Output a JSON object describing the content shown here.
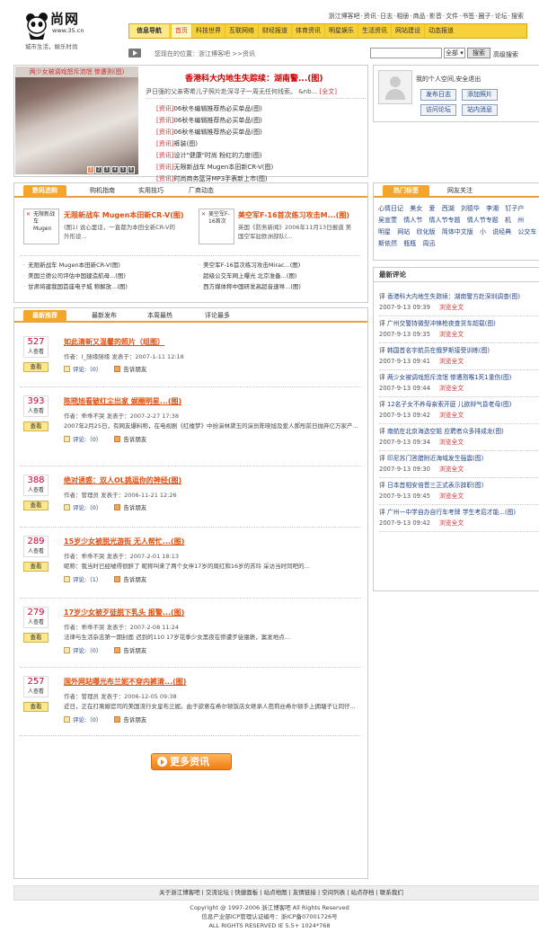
{
  "header": {
    "logo_text": "尚网",
    "logo_url": "www.35.cn",
    "logo_slogan": "城市生活，娱乐时尚",
    "top_links": [
      "浙江博客吧",
      "资讯",
      "日志",
      "相册",
      "商品",
      "影音",
      "文件",
      "书签",
      "圈子",
      "论坛",
      "搜索"
    ]
  },
  "nav": {
    "title": "信息导航",
    "items": [
      "首页",
      "科技世界",
      "互联网络",
      "财经报道",
      "体育资讯",
      "明星娱乐",
      "生活资讯",
      "网站建设",
      "动态报道"
    ]
  },
  "location": {
    "text": "您现在的位置：浙江博客吧 >>资讯"
  },
  "search": {
    "placeholder": "",
    "select_value": "全部",
    "button": "搜索",
    "advanced": "高级搜索"
  },
  "headline": {
    "photo_caption": "两少女被调戏怒斥流氓 惨遭割(图)",
    "photo_pages": [
      "1",
      "2",
      "3",
      "4",
      "5",
      "6"
    ],
    "title": "香港科大内地生失踪续：湖南警...(图)",
    "desc": "尹日强的父亲寄希儿子照片赴深寻子一周无任何线索。 &nb...",
    "more": "[全文]",
    "list": [
      {
        "tag": "[资讯]",
        "text": "06秋冬编辑推荐热必买单品(图)"
      },
      {
        "tag": "[资讯]",
        "text": "06秋冬编辑推荐热必买单品(图)"
      },
      {
        "tag": "[资讯]",
        "text": "06秋冬编辑推荐热必买单品(图)"
      },
      {
        "tag": "[资讯]",
        "text": "裤装(图)"
      },
      {
        "tag": "[资讯]",
        "text": "设计\"健康\"时尚 粉红的力度(图)"
      },
      {
        "tag": "[资讯]",
        "text": "无限新战车 Mugen本田新CR-V(图)"
      },
      {
        "tag": "[资讯]",
        "text": "时尚商务蓝牙MP3手表新上市(图)"
      }
    ]
  },
  "profile": {
    "text": "我的个人空间,安全退出",
    "buttons": [
      "发布日志",
      "添加照片",
      "访问论坛",
      "站内消息"
    ]
  },
  "buy": {
    "tabs": [
      "数码选购",
      "购机指南",
      "实用技巧",
      "厂商动态"
    ],
    "prod1": {
      "img_text": "无限新战车 Mugen",
      "title": "无限新战车 Mugen本田新CR-V(图)",
      "desc": "(图1) 说心里话，一直都为本田全新CR-V的外形设..."
    },
    "prod2": {
      "img_text": "美空军F-16首次",
      "title": "美空军F-16首次练习攻击M...(图)",
      "desc": "英国《防务新闻》2006年11月13日报道 美国空军驻欧洲部队(..."
    },
    "list_left": [
      "无限新战车 Mugen本田新CR-V(图)",
      "美国兰德公司评估中国建造航母...(图)",
      "甘肃将建我国首座电子城 称解放...(图)"
    ],
    "list_right": [
      "美空军F-16首次练习攻击Mirac...(图)",
      "超级公交车网上曝光 北京准备...(图)",
      "西方媒体称中国研发高超音速导...(图)"
    ]
  },
  "rank": {
    "tabs": [
      "最新推荐",
      "最新发布",
      "本周最热",
      "评论最多"
    ],
    "count_label": "人查看",
    "view_label": "查看",
    "report_label": "告诉朋友",
    "items": [
      {
        "count": "527",
        "title": "如此清新又温馨的照片（组图）",
        "meta": "作者：(_随缘随缘  发表于：2007-1-11 12:18",
        "summary": "",
        "comments": "评论:（0）"
      },
      {
        "count": "393",
        "title": "陈晓旭看破红尘出家 娱圈明星...(图)",
        "meta": "作者：乖乖不哭  发表于：2007-2-27 17:38",
        "summary": "2007年2月25日，有网友爆料称，在电视剧《红楼梦》中扮演林黛玉的演员陈晓旭及爱人郝彤前日抛弃亿万家产...",
        "comments": "评论:（0）"
      },
      {
        "count": "388",
        "title": "绝对诱惑：双人OL挑逗你的神经(图)",
        "meta": "作者：管理员  发表于：2006-11-21 12:26",
        "summary": "",
        "comments": "评论:（0）"
      },
      {
        "count": "289",
        "title": "15岁少女被脱光游街 无人帮忙...(图)",
        "meta": "作者：乖乖不哭  发表于：2007-2-01 18:13",
        "summary": "昵称：我当时已经嘘得很醉了 昵称叫来了两个女伴17岁的周红和16岁的苏玲 采访当时同吧的...",
        "comments": "评论:（1）"
      },
      {
        "count": "279",
        "title": "17岁少女被歹徒脱下乳头 报警...(图)",
        "meta": "作者：乖乖不哭  发表于：2007-2-08 11:24",
        "summary": "法律与生活杂志第一期封面 迟到的110  17岁花季少女黑夜在惨遭歹徒猥亵，案发地点...",
        "comments": "评论:（0）"
      },
      {
        "count": "257",
        "title": "国外网站曝光布兰妮不穿内裤清...(图)",
        "meta": "作者：管理员  发表于：2006-12-05 09:38",
        "summary": "近日，正在打离婚官司的美国流行女皇布兰妮。由于欲意在希尔顿饭店女继承人芭莉丝希尔顿手上拥塘子让同仔...",
        "comments": "评论:（0）"
      }
    ],
    "more_button": "更多资讯"
  },
  "tags": {
    "tabs": [
      "热门标签",
      "网友关注"
    ],
    "items": [
      "心情日记",
      "美女",
      "爱",
      "西湖",
      "刘德华",
      "李湘",
      "钉子户",
      "吴宣萱",
      "情人节",
      "情人节专题",
      "情人节专题",
      "机",
      "州",
      "明星",
      "网站",
      "欣化版",
      "简体中文版",
      "小",
      "说经典",
      "公交车",
      "斯依然",
      "瓶瓶",
      "周迅"
    ]
  },
  "comments": {
    "title": "最新评论",
    "items": [
      {
        "prefix": "评",
        "text": "香港科大内地生失踪续：湖南警方赴深圳调查(图)",
        "date": "2007-9-13 09:39",
        "action": "浏览全文"
      },
      {
        "prefix": "评",
        "text": "广州交警持微型冲锋枪夜查货车超载(图)",
        "date": "2007-9-13 09:35",
        "action": "浏览全文"
      },
      {
        "prefix": "评",
        "text": "韩国首名宇航员在俄罗斯接受训练(图)",
        "date": "2007-9-13 09:41",
        "action": "浏览全文"
      },
      {
        "prefix": "评",
        "text": "两少女被调戏怒斥流氓 惨遭割喉1死1重伤(图)",
        "date": "2007-9-13 09:44",
        "action": "浏览全文"
      },
      {
        "prefix": "评",
        "text": "12名子女不养母亲索开庭 儿欲辩气昏老母(图)",
        "date": "2007-9-13 09:42",
        "action": "浏览全文"
      },
      {
        "prefix": "评",
        "text": "南航在北京海选空姐 应聘者众多排成龙(图)",
        "date": "2007-9-13 09:34",
        "action": "浏览全文"
      },
      {
        "prefix": "评",
        "text": "印尼苏门答腊附近海域发生强震(图)",
        "date": "2007-9-13 09:30",
        "action": "浏览全文"
      },
      {
        "prefix": "评",
        "text": "日本首相安倍晋三正式表示辞职(图)",
        "date": "2007-9-13 09:45",
        "action": "浏览全文"
      },
      {
        "prefix": "评",
        "text": "广州一中学自办自行车考牌 学生考后才能...(图)",
        "date": "2007-9-13 09:42",
        "action": "浏览全文"
      }
    ]
  },
  "footer": {
    "links": "关于浙江博客吧 | 交流论坛 | 快捷面板 | 站点地图 | 友情链接 | 空间列表 | 站点存档 | 联系我们",
    "copyright": "Copyright @ 1997-2006 浙江博客吧 All Rights Reserved",
    "icp": "信息产业部ICP管理认证编号：浙ICP备07001726号",
    "rights": "ALL RIGHTS RESERVED IE 5.5+ 1024*768"
  }
}
